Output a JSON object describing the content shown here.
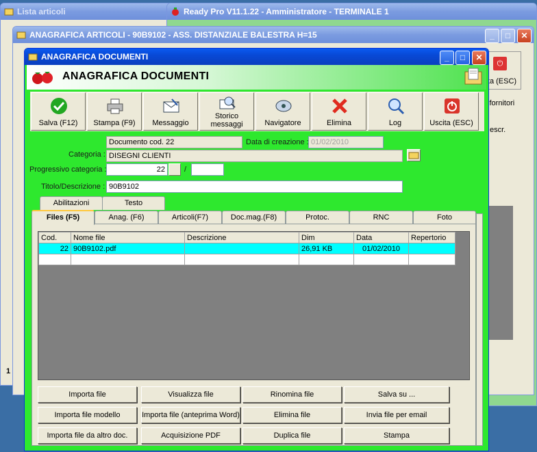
{
  "bg_windows": {
    "lista_title": "Lista articoli",
    "readypro_title": "Ready Pro V11.1.22 - Amministratore - TERMINALE 1",
    "anagrafica_articoli_title": "ANAGRAFICA ARTICOLI - 90B9102 - ASS. DISTANZIALE BALESTRA H=15",
    "peek_exit": "cita (ESC)",
    "peek_fornitori": "i fornitori",
    "peek_descr": "escr.",
    "peek_one": "1"
  },
  "window": {
    "title": "ANAGRAFICA DOCUMENTI",
    "banner_title": "ANAGRAFICA DOCUMENTI"
  },
  "toolbar": [
    {
      "label": "Salva (F12)",
      "icon": "checkmark-icon"
    },
    {
      "label": "Stampa (F9)",
      "icon": "printer-icon"
    },
    {
      "label": "Messaggio",
      "icon": "envelope-icon"
    },
    {
      "label": "Storico messaggi",
      "icon": "message-history-icon"
    },
    {
      "label": "Navigatore",
      "icon": "navigator-icon"
    },
    {
      "label": "Elimina",
      "icon": "delete-x-icon"
    },
    {
      "label": "Log",
      "icon": "log-icon"
    },
    {
      "label": "Uscita (ESC)",
      "icon": "power-icon"
    }
  ],
  "form": {
    "doc_code": "Documento cod. 22",
    "creation_label": "Data di creazione :",
    "creation_date": "01/02/2010",
    "categoria_label": "Categoria :",
    "categoria": "DISEGNI CLIENTI",
    "progressivo_label": "Progressivo categoria :",
    "progressivo": "22",
    "slash": "/",
    "progressivo_suffix": "",
    "titolo_label": "Titolo/Descrizione :",
    "titolo": "90B9102"
  },
  "tabs_row1": [
    "Abilitazioni",
    "Testo"
  ],
  "tabs_row2": [
    "Files (F5)",
    "Anag. (F6)",
    "Articoli(F7)",
    "Doc.mag.(F8)",
    "Protoc.",
    "RNC",
    "Foto"
  ],
  "grid": {
    "columns": [
      "Cod.",
      "Nome file",
      "Descrizione",
      "Dim",
      "Data",
      "Repertorio"
    ],
    "rows": [
      {
        "cod": "22",
        "nome": "90B9102.pdf",
        "descrizione": "",
        "dim": "26,91 KB",
        "data": "01/02/2010",
        "repertorio": ""
      }
    ]
  },
  "actions": [
    [
      "Importa file",
      "Visualizza file",
      "Rinomina file",
      "Salva su ..."
    ],
    [
      "Importa file modello",
      "Importa file (anteprima Word)",
      "Elimina file",
      "Invia file per email"
    ],
    [
      "Importa file da altro doc.",
      "Acquisizione PDF",
      "Duplica file",
      "Stampa"
    ]
  ],
  "colors": {
    "window_bg": "#2ee82e",
    "selected_row": "#00ffff",
    "titlebar_active": "#0a5bf0"
  }
}
